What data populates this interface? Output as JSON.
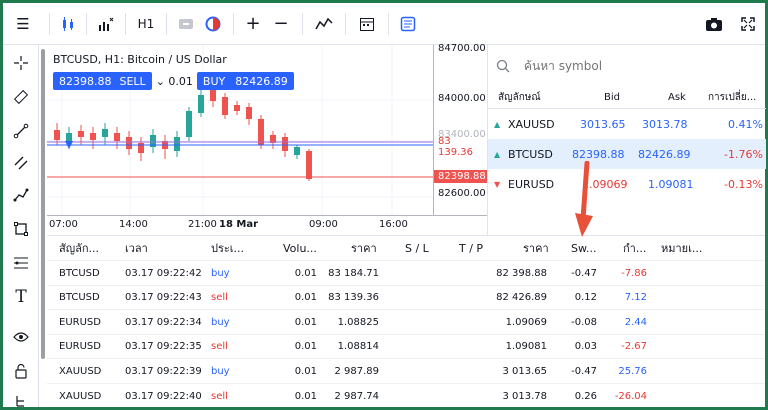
{
  "toolbar": {
    "timeframe": "H1"
  },
  "chart": {
    "title": "BTCUSD, H1: Bitcoin / US Dollar",
    "sell_price": "82398.88",
    "sell_label": "SELL",
    "lot": "0.01",
    "buy_label": "BUY",
    "buy_price": "82426.89",
    "price_labels": [
      "84700.00",
      "84000.00",
      "83400.00",
      "82600.00"
    ],
    "tag_entry": "83 139.36",
    "tag_current": "82398.88",
    "time_labels": [
      "07:00",
      "14:00",
      "21:00",
      "18 Mar",
      "09:00",
      "16:00"
    ]
  },
  "watchlist": {
    "search_placeholder": "ค้นหา symbol",
    "headers": [
      "สัญลักษณ์",
      "Bid",
      "Ask",
      "การเปลี่ย..."
    ],
    "rows": [
      {
        "symbol": "XAUUSD",
        "bid": "3013.65",
        "ask": "3013.78",
        "change": "0.41%",
        "dir": "up"
      },
      {
        "symbol": "BTCUSD",
        "bid": "82398.88",
        "ask": "82426.89",
        "change": "-1.76%",
        "dir": "up"
      },
      {
        "symbol": "EURUSD",
        "bid": "1.09069",
        "ask": "1.09081",
        "change": "-0.13%",
        "dir": "down"
      }
    ]
  },
  "positions": {
    "headers": [
      "สัญลัก...",
      "เวลา",
      "ประเ...",
      "Volu...",
      "ราคา",
      "S / L",
      "T / P",
      "ราคา",
      "Sw...",
      "กำ...",
      "หมายเ..."
    ],
    "rows": [
      {
        "symbol": "BTCUSD",
        "time": "03.17 09:22:42",
        "type": "buy",
        "volume": "0.01",
        "open": "83 184.71",
        "current": "82 398.88",
        "swap": "-0.47",
        "profit": "-7.86"
      },
      {
        "symbol": "BTCUSD",
        "time": "03.17 09:22:43",
        "type": "sell",
        "volume": "0.01",
        "open": "83 139.36",
        "current": "82 426.89",
        "swap": "0.12",
        "profit": "7.12"
      },
      {
        "symbol": "EURUSD",
        "time": "03.17 09:22:34",
        "type": "buy",
        "volume": "0.01",
        "open": "1.08825",
        "current": "1.09069",
        "swap": "-0.08",
        "profit": "2.44"
      },
      {
        "symbol": "EURUSD",
        "time": "03.17 09:22:35",
        "type": "sell",
        "volume": "0.01",
        "open": "1.08814",
        "current": "1.09081",
        "swap": "0.03",
        "profit": "-2.67"
      },
      {
        "symbol": "XAUUSD",
        "time": "03.17 09:22:39",
        "type": "buy",
        "volume": "0.01",
        "open": "2 987.89",
        "current": "3 013.65",
        "swap": "-0.47",
        "profit": "25.76"
      },
      {
        "symbol": "XAUUSD",
        "time": "03.17 09:22:40",
        "type": "sell",
        "volume": "0.01",
        "open": "2 987.74",
        "current": "3 013.78",
        "swap": "0.26",
        "profit": "-26.04"
      }
    ]
  },
  "colors": {
    "accent": "#2962ff",
    "up": "#26a69a",
    "down": "#ef5350",
    "frame": "#1f7a4d",
    "arrow": "#e8503a"
  }
}
